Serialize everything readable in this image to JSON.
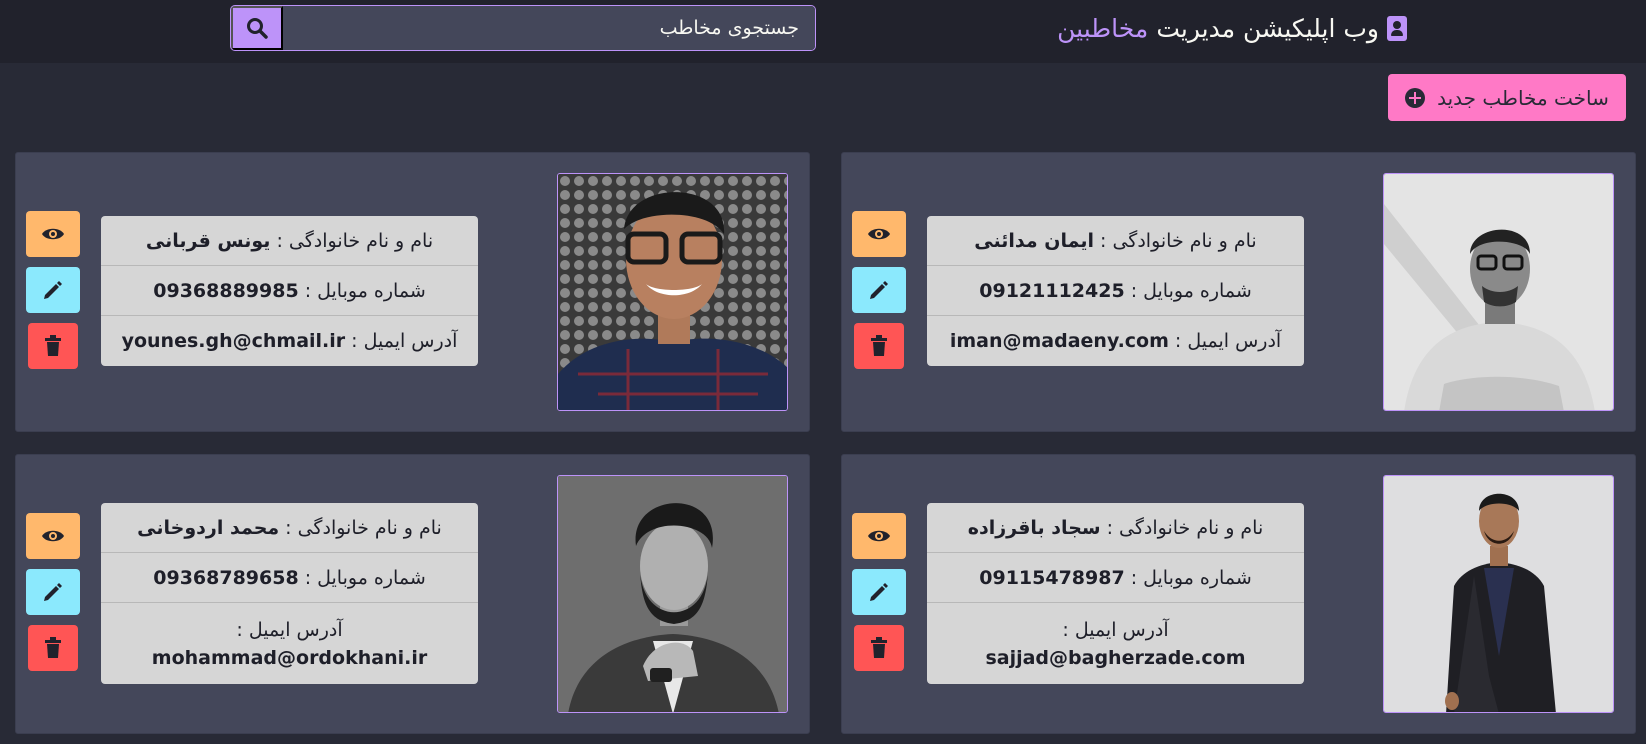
{
  "header": {
    "brand_prefix": "وب اپلیکیشن مدیریت",
    "brand_accent": "مخاطبین",
    "search_placeholder": "جستجوی مخاطب"
  },
  "create_button_label": "ساخت مخاطب جدید",
  "labels": {
    "fullname": "نام و نام خانوادگی :",
    "mobile": "شماره موبایل :",
    "email": "آدرس ایمیل :"
  },
  "contacts": [
    {
      "fullname": "ایمان مدائنی",
      "mobile": "09121112425",
      "email": "iman@madaeny.com"
    },
    {
      "fullname": "یونس قربانی",
      "mobile": "09368889985",
      "email": "younes.gh@chmail.ir"
    },
    {
      "fullname": "سجاد باقرزاده",
      "mobile": "09115478987",
      "email": "sajjad@bagherzade.com"
    },
    {
      "fullname": "محمد اردوخانی",
      "mobile": "09368789658",
      "email": "mohammad@ordokhani.ir"
    }
  ],
  "colors": {
    "background": "#282a36",
    "navbar": "#21222c",
    "card": "#44475a",
    "purple": "#bd93f9",
    "pink": "#ff79c6",
    "orange": "#ffb86c",
    "cyan": "#8be9fd",
    "red": "#ff5555"
  }
}
